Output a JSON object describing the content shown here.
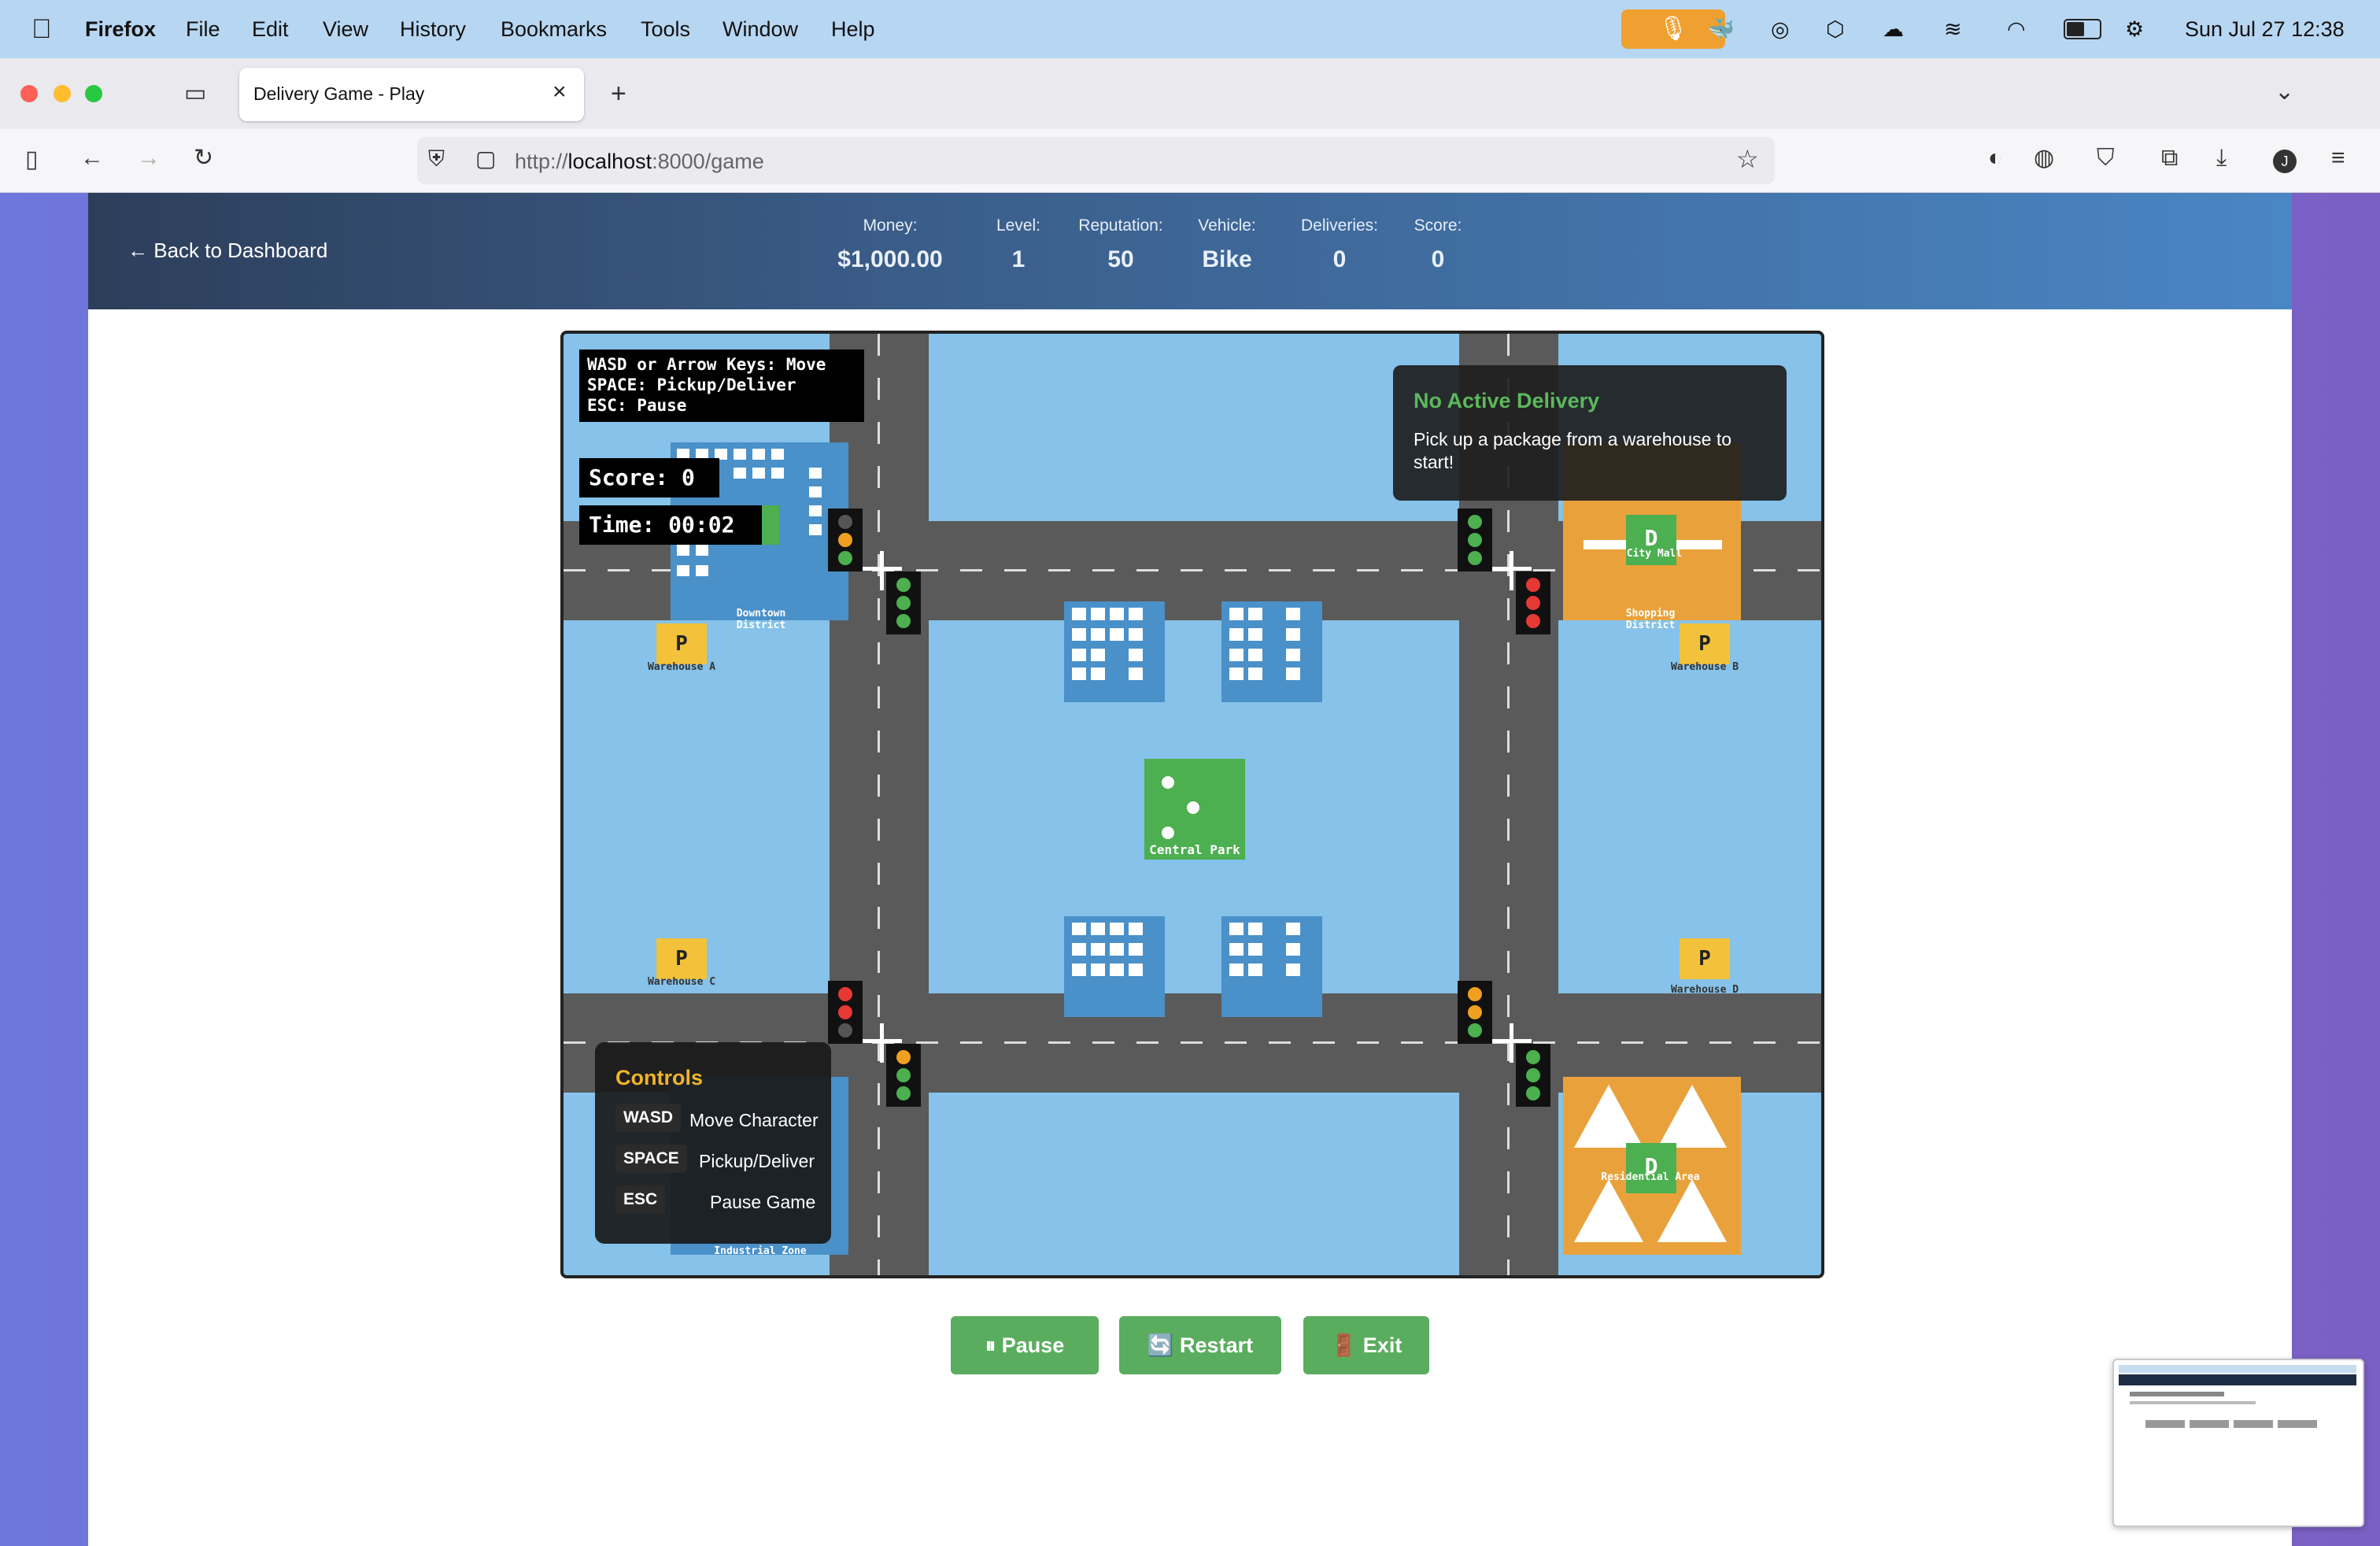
{
  "menubar": {
    "app": "Firefox",
    "items": [
      "File",
      "Edit",
      "View",
      "History",
      "Bookmarks",
      "Tools",
      "Window",
      "Help"
    ],
    "datetime": "Sun Jul 27  12:38"
  },
  "browser": {
    "tab_title": "Delivery Game - Play",
    "url_prefix": "http://",
    "url_host": "localhost",
    "url_rest": ":8000/game"
  },
  "header": {
    "back_label": "← Back to Dashboard",
    "stats": [
      {
        "label": "Money:",
        "value": "$1,000.00"
      },
      {
        "label": "Level:",
        "value": "1"
      },
      {
        "label": "Reputation:",
        "value": "50"
      },
      {
        "label": "Vehicle:",
        "value": "Bike"
      },
      {
        "label": "Deliveries:",
        "value": "0"
      },
      {
        "label": "Score:",
        "value": "0"
      }
    ]
  },
  "game": {
    "help_lines": [
      "WASD or Arrow Keys: Move",
      "SPACE: Pickup/Deliver",
      "ESC: Pause"
    ],
    "score_text": "Score: 0",
    "time_text": "Time: 00:02",
    "delivery_title": "No Active Delivery",
    "delivery_text": "Pick up a package from a warehouse to start!",
    "labels": {
      "downtown": "Downtown District",
      "shopping": "Shopping District",
      "city_mall": "City Mall",
      "central_park": "Central Park",
      "warehouse_a": "Warehouse A",
      "warehouse_b": "Warehouse B",
      "warehouse_c": "Warehouse C",
      "warehouse_d": "Warehouse D",
      "industrial": "Industrial Zone",
      "residential": "Residential Area",
      "p": "P",
      "d": "D"
    },
    "controls": {
      "title": "Controls",
      "rows": [
        {
          "key": "WASD",
          "desc": "Move Character"
        },
        {
          "key": "SPACE",
          "desc": "Pickup/Deliver"
        },
        {
          "key": "ESC",
          "desc": "Pause Game"
        }
      ]
    }
  },
  "buttons": {
    "pause": "⏸ Pause",
    "restart": "🔄 Restart",
    "exit": "🚪 Exit"
  },
  "colors": {
    "accent_green": "#5aad5e",
    "map_water": "#86c2e9",
    "road": "#5a5a5a",
    "building": "#4a90c9",
    "warehouse": "#f2c23a",
    "district_orange": "#e9a23b"
  }
}
